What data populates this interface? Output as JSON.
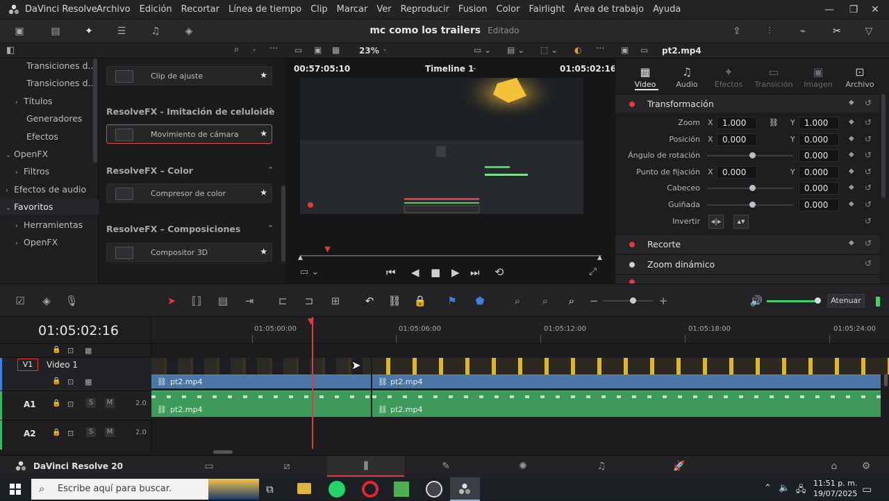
{
  "app": {
    "title": "DaVinci Resolve"
  },
  "menu": [
    "Archivo",
    "Edición",
    "Recortar",
    "Línea de tiempo",
    "Clip",
    "Marcar",
    "Ver",
    "Reproducir",
    "Fusion",
    "Color",
    "Fairlight",
    "Área de trabajo",
    "Ayuda"
  ],
  "project": {
    "title": "mc como los trailers",
    "status": "Editado"
  },
  "tree": {
    "items": [
      {
        "label": "Transiciones d...",
        "indent": 38,
        "caret": ""
      },
      {
        "label": "Transiciones d...",
        "indent": 38,
        "caret": ""
      },
      {
        "label": "Títulos",
        "indent": 22,
        "caret": "›"
      },
      {
        "label": "Generadores",
        "indent": 38,
        "caret": ""
      },
      {
        "label": "Efectos",
        "indent": 38,
        "caret": ""
      },
      {
        "label": "OpenFX",
        "indent": 8,
        "caret": "⌄"
      },
      {
        "label": "Filtros",
        "indent": 22,
        "caret": "›"
      },
      {
        "label": "Efectos de audio",
        "indent": 8,
        "caret": "›"
      },
      {
        "label": "Favoritos",
        "indent": 8,
        "caret": "⌄"
      },
      {
        "label": "Herramientas",
        "indent": 22,
        "caret": "›"
      },
      {
        "label": "OpenFX",
        "indent": 22,
        "caret": "›"
      }
    ]
  },
  "fx": {
    "cards": [
      {
        "label": "Clip de ajuste"
      },
      {
        "label": "Movimiento de cámara"
      },
      {
        "label": "Compresor de color"
      },
      {
        "label": "Compositor 3D"
      }
    ],
    "headers": [
      "ResolveFX - Imitación de celuloide",
      "ResolveFX – Color",
      "ResolveFX – Composiciones"
    ]
  },
  "viewer": {
    "zoom": "23%",
    "tc_left": "00:57:05:10",
    "timeline": "Timeline 1",
    "tc_right": "01:05:02:16",
    "playhead_progress": 0.0905
  },
  "inspector": {
    "clip": "pt2.mp4",
    "tabs": [
      "Video",
      "Audio",
      "Efectos",
      "Transición",
      "Imagen",
      "Archivo"
    ],
    "transform": {
      "title": "Transformación",
      "zoom": {
        "label": "Zoom",
        "x": "1.000",
        "y": "1.000"
      },
      "pos": {
        "label": "Posición",
        "x": "0.000",
        "y": "0.000"
      },
      "rot": {
        "label": "Ángulo de rotación",
        "v": "0.000"
      },
      "anchor": {
        "label": "Punto de fijación",
        "x": "0.000",
        "y": "0.000"
      },
      "pitch": {
        "label": "Cabeceo",
        "v": "0.000"
      },
      "yaw": {
        "label": "Guiñada",
        "v": "0.000"
      },
      "flip": {
        "label": "Invertir"
      }
    },
    "crop": "Recorte",
    "dynzoom": "Zoom dinámico",
    "axis": {
      "x": "X",
      "y": "Y"
    }
  },
  "timeline": {
    "timecode": "01:05:02:16",
    "ruler": [
      "01:05:00:00",
      "01:05:06:00",
      "01:05:12:00",
      "01:05:18:00",
      "01:05:24:00"
    ],
    "v1": {
      "badge": "V1",
      "name": "Video 1"
    },
    "a1": {
      "badge": "A1",
      "level": "2.0"
    },
    "a2": {
      "badge": "A2",
      "level": "2.0"
    },
    "solo": "S",
    "mute": "M",
    "clip_name": "pt2.mp4",
    "attenuate": "Atenuar"
  },
  "pagebar": {
    "brand": "DaVinci Resolve 20"
  },
  "taskbar": {
    "search_placeholder": "Escribe aquí para buscar.",
    "time": "11:51 p. m.",
    "date": "19/07/2025"
  },
  "colors": {
    "accent_red": "#e0393e",
    "video_clip": "#4b76a6",
    "audio_clip": "#3e9a5a"
  }
}
